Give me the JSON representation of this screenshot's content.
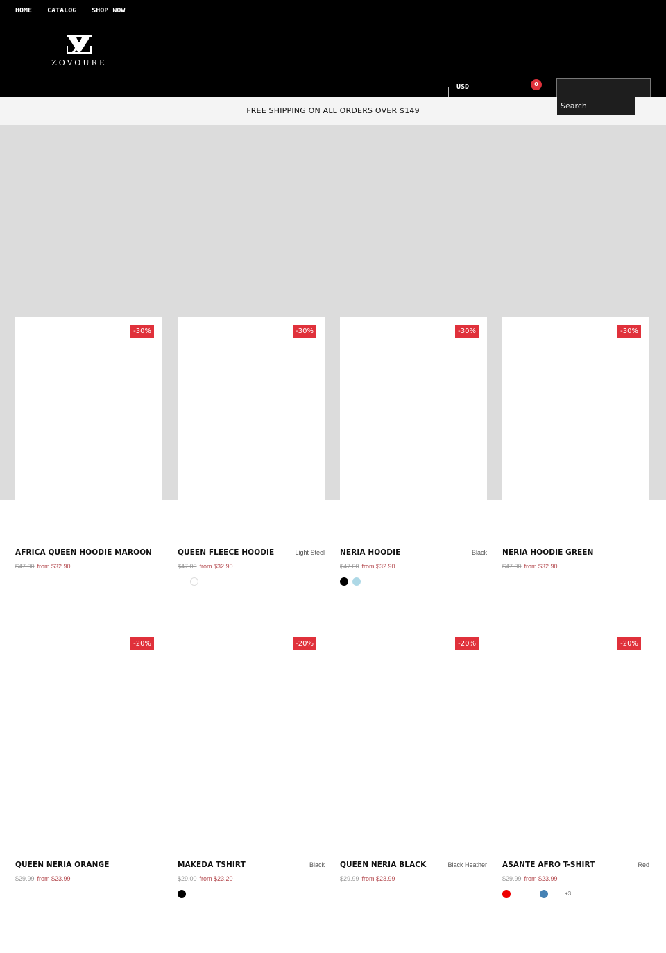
{
  "nav": {
    "items": [
      {
        "label": "HOME"
      },
      {
        "label": "CATALOG"
      },
      {
        "label": "SHOP NOW"
      }
    ]
  },
  "brand": {
    "name": "ZOVOURE",
    "logo_icon": "zv-monogram-icon"
  },
  "header": {
    "currency": "USD",
    "cart_count": "0",
    "search_placeholder": "Search"
  },
  "announcement": {
    "text": "FREE SHIPPING ON ALL ORDERS OVER $149"
  },
  "colors": {
    "header_bg": "#000000",
    "accent_red": "#e0313b",
    "sale_price": "#b44a4f",
    "hero_bg": "#dcdcdc",
    "announcement_bg": "#f4f4f4"
  },
  "products": [
    {
      "title": "AFRICA QUEEN HOODIE MAROON",
      "badge": "-30%",
      "variant": "",
      "old_price": "$47.00",
      "price": "from $32.90",
      "swatches": [],
      "more": ""
    },
    {
      "title": "QUEEN FLEECE HOODIE",
      "badge": "-30%",
      "variant": "Light Steel",
      "old_price": "$47.00",
      "price": "from $32.90",
      "swatches": [
        "#ffffff",
        "#ffffff"
      ],
      "more": ""
    },
    {
      "title": "NERIA HOODIE",
      "badge": "-30%",
      "variant": "Black",
      "old_price": "$47.00",
      "price": "from $32.90",
      "swatches": [
        "#000000",
        "#add8e6"
      ],
      "more": ""
    },
    {
      "title": "NERIA HOODIE GREEN",
      "badge": "-30%",
      "variant": "",
      "old_price": "$47.00",
      "price": "from $32.90",
      "swatches": [],
      "more": ""
    },
    {
      "title": "QUEEN NERIA ORANGE",
      "badge": "-20%",
      "variant": "",
      "old_price": "$29.99",
      "price": "from $23.99",
      "swatches": [],
      "more": ""
    },
    {
      "title": "MAKEDA TSHIRT",
      "badge": "-20%",
      "variant": "Black",
      "old_price": "$29.00",
      "price": "from $23.20",
      "swatches": [
        "#000000"
      ],
      "more": ""
    },
    {
      "title": "QUEEN NERIA BLACK",
      "badge": "-20%",
      "variant": "Black Heather",
      "old_price": "$29.99",
      "price": "from $23.99",
      "swatches": [],
      "more": ""
    },
    {
      "title": "ASANTE AFRO T-SHIRT",
      "badge": "-20%",
      "variant": "Red",
      "old_price": "$29.99",
      "price": "from $23.99",
      "swatches": [
        "#ee0000",
        "#ffffff",
        "#ffffff",
        "#4682b4"
      ],
      "more": "+3"
    }
  ]
}
